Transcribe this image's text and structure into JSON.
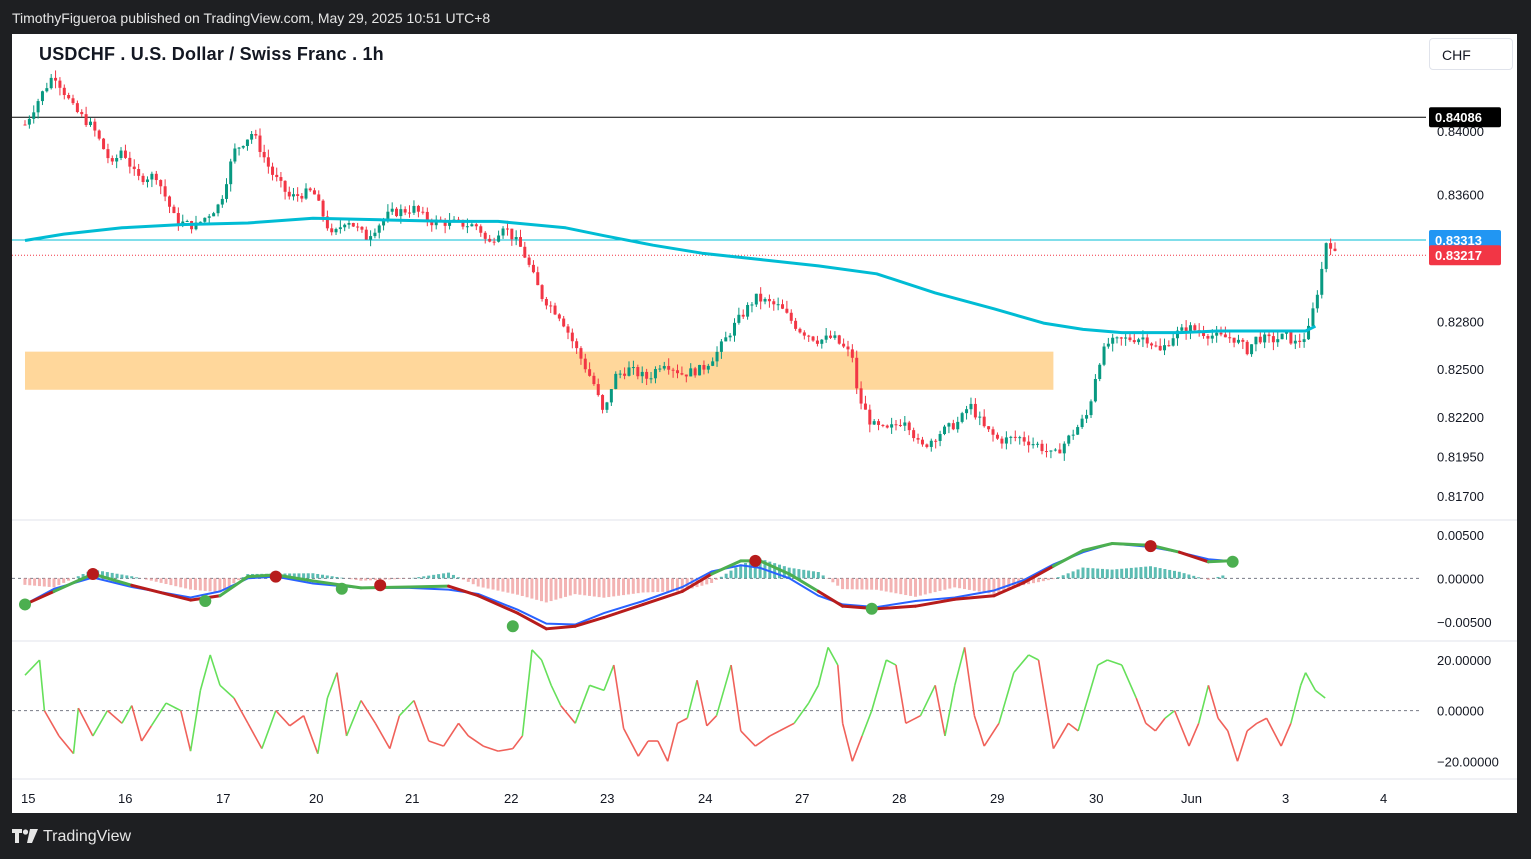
{
  "header": {
    "publisher_line": "TimothyFigueroa published on TradingView.com, May 29, 2025 10:51 UTC+8"
  },
  "chart": {
    "title": "USDCHF . U.S. Dollar / Swiss Franc . 1h",
    "currency_button": "CHF",
    "colors": {
      "up": "#089981",
      "down": "#f23645",
      "ma": "#00bcd4",
      "zone": "#ffd08a",
      "green": "#4caf50",
      "red": "#b71c1c",
      "blue": "#2962ff"
    }
  },
  "footer": {
    "brand": "TradingView"
  },
  "chart_data": [
    {
      "type": "candlestick",
      "title": "USDCHF . U.S. Dollar / Swiss Franc . 1h",
      "x_ticks": [
        "15",
        "16",
        "17",
        "20",
        "21",
        "22",
        "23",
        "24",
        "27",
        "28",
        "29",
        "30",
        "Jun",
        "3",
        "4"
      ],
      "y_ticks": [
        "0.84000",
        "0.83600",
        "0.82800",
        "0.82500",
        "0.82200",
        "0.81950",
        "0.81700"
      ],
      "ylim": [
        0.8155,
        0.8461
      ],
      "price_labels": [
        {
          "label": "0.84086",
          "value": 0.84086,
          "style": "black"
        },
        {
          "label": "0.83313",
          "value": 0.83313,
          "style": "blue"
        },
        {
          "label": "0.83217",
          "value": 0.83217,
          "style": "red"
        }
      ],
      "zone": {
        "from_x": 15.0,
        "to_x": 25.6,
        "low": 0.8237,
        "high": 0.8261
      },
      "moving_average_anchors": [
        [
          15.0,
          0.8331
        ],
        [
          15.4,
          0.8335
        ],
        [
          16.0,
          0.8339
        ],
        [
          16.6,
          0.8341
        ],
        [
          17.3,
          0.8342
        ],
        [
          18.0,
          0.8345
        ],
        [
          18.7,
          0.8344
        ],
        [
          19.4,
          0.8343
        ],
        [
          19.9,
          0.8343
        ],
        [
          20.6,
          0.8339
        ],
        [
          21.0,
          0.8334
        ],
        [
          21.5,
          0.8328
        ],
        [
          22.0,
          0.8323
        ],
        [
          22.6,
          0.8319
        ],
        [
          23.2,
          0.8315
        ],
        [
          23.8,
          0.831
        ],
        [
          24.4,
          0.8298
        ],
        [
          25.0,
          0.8288
        ],
        [
          25.5,
          0.8279
        ],
        [
          25.9,
          0.8275
        ],
        [
          26.3,
          0.8273
        ],
        [
          26.9,
          0.8273
        ],
        [
          27.3,
          0.8274
        ],
        [
          27.8,
          0.8274
        ],
        [
          28.2,
          0.8274
        ],
        [
          28.3,
          0.8277
        ]
      ],
      "candle_anchors": [
        [
          15.0,
          0.8404
        ],
        [
          15.15,
          0.8421
        ],
        [
          15.3,
          0.8436
        ],
        [
          15.5,
          0.8414
        ],
        [
          15.7,
          0.8402
        ],
        [
          15.9,
          0.8378
        ],
        [
          16.0,
          0.8389
        ],
        [
          16.15,
          0.837
        ],
        [
          16.35,
          0.8372
        ],
        [
          16.55,
          0.8343
        ],
        [
          16.75,
          0.834
        ],
        [
          17.0,
          0.8354
        ],
        [
          17.15,
          0.8387
        ],
        [
          17.35,
          0.8399
        ],
        [
          17.55,
          0.8374
        ],
        [
          17.75,
          0.8358
        ],
        [
          18.0,
          0.8362
        ],
        [
          18.2,
          0.8333
        ],
        [
          18.35,
          0.8345
        ],
        [
          18.55,
          0.8333
        ],
        [
          18.8,
          0.8348
        ],
        [
          19.05,
          0.8351
        ],
        [
          19.2,
          0.8343
        ],
        [
          19.45,
          0.8342
        ],
        [
          19.7,
          0.834
        ],
        [
          19.8,
          0.8328
        ],
        [
          19.95,
          0.8341
        ],
        [
          20.15,
          0.8325
        ],
        [
          20.35,
          0.8296
        ],
        [
          20.55,
          0.8283
        ],
        [
          20.7,
          0.8264
        ],
        [
          20.9,
          0.824
        ],
        [
          21.0,
          0.822
        ],
        [
          21.1,
          0.8245
        ],
        [
          21.25,
          0.825
        ],
        [
          21.45,
          0.8244
        ],
        [
          21.6,
          0.8255
        ],
        [
          21.8,
          0.8247
        ],
        [
          22.0,
          0.825
        ],
        [
          22.15,
          0.826
        ],
        [
          22.35,
          0.8279
        ],
        [
          22.55,
          0.8295
        ],
        [
          22.8,
          0.8289
        ],
        [
          23.0,
          0.8275
        ],
        [
          23.2,
          0.8268
        ],
        [
          23.35,
          0.827
        ],
        [
          23.55,
          0.8258
        ],
        [
          23.6,
          0.8234
        ],
        [
          23.75,
          0.8215
        ],
        [
          23.9,
          0.8211
        ],
        [
          24.1,
          0.8219
        ],
        [
          24.25,
          0.82
        ],
        [
          24.45,
          0.821
        ],
        [
          24.65,
          0.8217
        ],
        [
          24.75,
          0.8228
        ],
        [
          24.9,
          0.8213
        ],
        [
          25.05,
          0.8205
        ],
        [
          25.25,
          0.8207
        ],
        [
          25.45,
          0.8202
        ],
        [
          25.6,
          0.8195
        ],
        [
          25.8,
          0.821
        ],
        [
          25.95,
          0.8222
        ],
        [
          26.05,
          0.8253
        ],
        [
          26.15,
          0.8266
        ],
        [
          26.35,
          0.8269
        ],
        [
          26.55,
          0.827
        ],
        [
          26.7,
          0.8261
        ],
        [
          26.85,
          0.8272
        ],
        [
          27.0,
          0.8276
        ],
        [
          27.15,
          0.8273
        ],
        [
          27.3,
          0.827
        ],
        [
          27.45,
          0.827
        ],
        [
          27.6,
          0.8262
        ],
        [
          27.7,
          0.827
        ],
        [
          27.85,
          0.8268
        ],
        [
          28.0,
          0.8271
        ],
        [
          28.1,
          0.8266
        ],
        [
          28.22,
          0.8272
        ],
        [
          28.35,
          0.8307
        ],
        [
          28.42,
          0.8334
        ],
        [
          28.5,
          0.8322
        ]
      ]
    },
    {
      "type": "line",
      "title": "",
      "y_ticks": [
        "0.00500",
        "0.00000",
        "-0.00500"
      ],
      "ylim": [
        -0.0072,
        0.0067
      ],
      "series": [
        {
          "anchors": [
            [
              15.0,
              -0.003
            ],
            [
              15.3,
              -0.0015
            ],
            [
              15.7,
              0.0005
            ],
            [
              16.1,
              -0.0008
            ],
            [
              16.7,
              -0.0025
            ],
            [
              17.0,
              -0.002
            ],
            [
              17.3,
              0.0002
            ],
            [
              17.6,
              0.0004
            ],
            [
              18.0,
              -0.0003
            ],
            [
              18.5,
              -0.0011
            ],
            [
              19.0,
              -0.001
            ],
            [
              19.4,
              -0.0009
            ],
            [
              19.7,
              -0.002
            ],
            [
              20.1,
              -0.004
            ],
            [
              20.4,
              -0.0058
            ],
            [
              20.7,
              -0.0055
            ],
            [
              21.0,
              -0.0045
            ],
            [
              21.4,
              -0.003
            ],
            [
              21.8,
              -0.0015
            ],
            [
              22.1,
              0.0005
            ],
            [
              22.4,
              0.002
            ],
            [
              22.6,
              0.002
            ],
            [
              22.9,
              0.0005
            ],
            [
              23.2,
              -0.0015
            ],
            [
              23.45,
              -0.0032
            ],
            [
              23.8,
              -0.0035
            ],
            [
              24.2,
              -0.0032
            ],
            [
              24.6,
              -0.0024
            ],
            [
              25.0,
              -0.002
            ],
            [
              25.3,
              -0.0005
            ],
            [
              25.6,
              0.0014
            ],
            [
              25.9,
              0.0032
            ],
            [
              26.2,
              0.004
            ],
            [
              26.6,
              0.0038
            ],
            [
              26.9,
              0.003
            ],
            [
              27.2,
              0.0019
            ],
            [
              27.4,
              0.002
            ]
          ]
        },
        {
          "anchors": [
            [
              15.0,
              -0.003
            ],
            [
              15.3,
              -0.0012
            ],
            [
              15.7,
              0.0001
            ],
            [
              16.1,
              -0.001
            ],
            [
              16.7,
              -0.0022
            ],
            [
              17.0,
              -0.0015
            ],
            [
              17.3,
              0.0
            ],
            [
              17.6,
              0.0002
            ],
            [
              18.0,
              -0.0006
            ],
            [
              18.5,
              -0.0011
            ],
            [
              19.0,
              -0.0011
            ],
            [
              19.4,
              -0.0013
            ],
            [
              19.7,
              -0.0018
            ],
            [
              20.1,
              -0.0036
            ],
            [
              20.4,
              -0.0052
            ],
            [
              20.7,
              -0.0053
            ],
            [
              21.0,
              -0.004
            ],
            [
              21.4,
              -0.0026
            ],
            [
              21.8,
              -0.001
            ],
            [
              22.1,
              0.0008
            ],
            [
              22.4,
              0.0015
            ],
            [
              22.6,
              0.0012
            ],
            [
              22.9,
              0.0
            ],
            [
              23.2,
              -0.002
            ],
            [
              23.45,
              -0.003
            ],
            [
              23.8,
              -0.0033
            ],
            [
              24.2,
              -0.0026
            ],
            [
              24.6,
              -0.0022
            ],
            [
              25.0,
              -0.0014
            ],
            [
              25.3,
              -0.0002
            ],
            [
              25.6,
              0.0016
            ],
            [
              25.9,
              0.003
            ],
            [
              26.2,
              0.004
            ],
            [
              26.6,
              0.0036
            ],
            [
              26.9,
              0.003
            ],
            [
              27.2,
              0.0022
            ],
            [
              27.4,
              0.002
            ]
          ]
        }
      ],
      "crossovers": [
        [
          15.0,
          -0.003,
          "up"
        ],
        [
          15.7,
          0.0005,
          "down"
        ],
        [
          16.85,
          -0.0026,
          "up"
        ],
        [
          17.6,
          0.0002,
          "down"
        ],
        [
          18.3,
          -0.0012,
          "up"
        ],
        [
          18.7,
          -0.0008,
          "down"
        ],
        [
          20.05,
          -0.0055,
          "up"
        ],
        [
          22.55,
          0.002,
          "down"
        ],
        [
          23.75,
          -0.0035,
          "up"
        ],
        [
          26.6,
          0.0037,
          "down"
        ],
        [
          27.45,
          0.0019,
          "up"
        ]
      ]
    },
    {
      "type": "line",
      "title": "",
      "y_ticks": [
        "20.00000",
        "0.00000",
        "-20.00000"
      ],
      "ylim": [
        -27.0,
        27.5
      ],
      "anchors": [
        [
          15.0,
          14
        ],
        [
          15.15,
          20
        ],
        [
          15.2,
          0
        ],
        [
          15.35,
          -10
        ],
        [
          15.5,
          -17
        ],
        [
          15.55,
          1
        ],
        [
          15.7,
          -10
        ],
        [
          15.85,
          0
        ],
        [
          16.0,
          -5
        ],
        [
          16.1,
          2
        ],
        [
          16.2,
          -12
        ],
        [
          16.3,
          -6
        ],
        [
          16.45,
          3
        ],
        [
          16.6,
          0
        ],
        [
          16.7,
          -16
        ],
        [
          16.8,
          8
        ],
        [
          16.9,
          22
        ],
        [
          17.0,
          10
        ],
        [
          17.15,
          5
        ],
        [
          17.3,
          -5
        ],
        [
          17.45,
          -15
        ],
        [
          17.6,
          0
        ],
        [
          17.75,
          -6
        ],
        [
          17.9,
          -2
        ],
        [
          18.05,
          -17
        ],
        [
          18.15,
          5
        ],
        [
          18.25,
          15
        ],
        [
          18.35,
          -10
        ],
        [
          18.5,
          4
        ],
        [
          18.65,
          -5
        ],
        [
          18.8,
          -15
        ],
        [
          18.9,
          -2
        ],
        [
          19.05,
          4
        ],
        [
          19.2,
          -12
        ],
        [
          19.35,
          -14
        ],
        [
          19.5,
          -5
        ],
        [
          19.6,
          -10
        ],
        [
          19.75,
          -14
        ],
        [
          19.9,
          -16
        ],
        [
          20.05,
          -15
        ],
        [
          20.15,
          -10
        ],
        [
          20.25,
          24
        ],
        [
          20.35,
          20
        ],
        [
          20.45,
          10
        ],
        [
          20.55,
          2
        ],
        [
          20.7,
          -5
        ],
        [
          20.85,
          10
        ],
        [
          21.0,
          8
        ],
        [
          21.1,
          18
        ],
        [
          21.2,
          -7
        ],
        [
          21.35,
          -18
        ],
        [
          21.45,
          -12
        ],
        [
          21.55,
          -12
        ],
        [
          21.65,
          -20
        ],
        [
          21.75,
          -5
        ],
        [
          21.85,
          -3
        ],
        [
          21.95,
          12
        ],
        [
          22.05,
          -6
        ],
        [
          22.15,
          -2
        ],
        [
          22.3,
          18
        ],
        [
          22.4,
          -8
        ],
        [
          22.55,
          -14
        ],
        [
          22.7,
          -10
        ],
        [
          22.8,
          -8
        ],
        [
          22.95,
          -5
        ],
        [
          23.1,
          3
        ],
        [
          23.2,
          10
        ],
        [
          23.3,
          25
        ],
        [
          23.4,
          18
        ],
        [
          23.45,
          -5
        ],
        [
          23.55,
          -20
        ],
        [
          23.65,
          -10
        ],
        [
          23.75,
          0
        ],
        [
          23.9,
          20
        ],
        [
          24.0,
          18
        ],
        [
          24.1,
          -5
        ],
        [
          24.25,
          -2
        ],
        [
          24.4,
          10
        ],
        [
          24.5,
          -10
        ],
        [
          24.6,
          10
        ],
        [
          24.7,
          25
        ],
        [
          24.8,
          -2
        ],
        [
          24.9,
          -14
        ],
        [
          25.05,
          -5
        ],
        [
          25.2,
          15
        ],
        [
          25.35,
          22
        ],
        [
          25.45,
          20
        ],
        [
          25.6,
          -15
        ],
        [
          25.75,
          -5
        ],
        [
          25.85,
          -8
        ],
        [
          25.95,
          5
        ],
        [
          26.05,
          18
        ],
        [
          26.15,
          20
        ],
        [
          26.3,
          18
        ],
        [
          26.45,
          5
        ],
        [
          26.55,
          -5
        ],
        [
          26.65,
          -8
        ],
        [
          26.75,
          -3
        ],
        [
          26.85,
          0
        ],
        [
          27.0,
          -14
        ],
        [
          27.1,
          -5
        ],
        [
          27.2,
          10
        ],
        [
          27.3,
          -3
        ],
        [
          27.4,
          -8
        ],
        [
          27.5,
          -20
        ],
        [
          27.6,
          -8
        ],
        [
          27.7,
          -5
        ],
        [
          27.8,
          -3
        ],
        [
          27.95,
          -14
        ],
        [
          28.05,
          -5
        ],
        [
          28.15,
          10
        ],
        [
          28.2,
          15
        ],
        [
          28.3,
          8
        ],
        [
          28.4,
          5
        ]
      ]
    }
  ]
}
